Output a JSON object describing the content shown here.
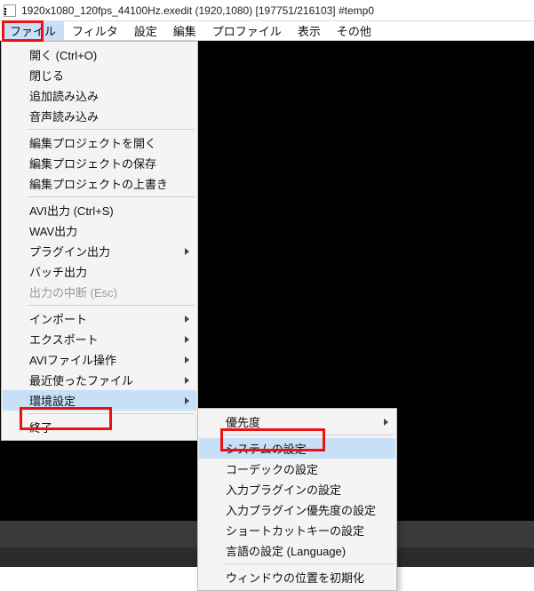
{
  "title": "1920x1080_120fps_44100Hz.exedit (1920,1080)  [197751/216103]  #temp0",
  "menubar": {
    "file": "ファイル",
    "filter": "フィルタ",
    "settings": "設定",
    "edit": "編集",
    "profile": "プロファイル",
    "view": "表示",
    "other": "その他"
  },
  "file_menu": {
    "open": "開く (Ctrl+O)",
    "close": "閉じる",
    "additional_load": "追加読み込み",
    "audio_load": "音声読み込み",
    "open_edit_project": "編集プロジェクトを開く",
    "save_edit_project": "編集プロジェクトの保存",
    "overwrite_edit_project": "編集プロジェクトの上書き",
    "avi_out": "AVI出力 (Ctrl+S)",
    "wav_out": "WAV出力",
    "plugin_out": "プラグイン出力",
    "batch_out": "バッチ出力",
    "abort_out": "出力の中断 (Esc)",
    "import": "インポート",
    "export": "エクスポート",
    "avi_file_ops": "AVIファイル操作",
    "recent_files": "最近使ったファイル",
    "env_settings": "環境設定",
    "exit": "終了"
  },
  "env_submenu": {
    "priority": "優先度",
    "system_settings": "システムの設定",
    "codec_settings": "コーデックの設定",
    "input_plugin_settings": "入力プラグインの設定",
    "input_plugin_priority": "入力プラグイン優先度の設定",
    "shortcut_settings": "ショートカットキーの設定",
    "language_settings": "言語の設定 (Language)",
    "reset_window_pos": "ウィンドウの位置を初期化"
  }
}
